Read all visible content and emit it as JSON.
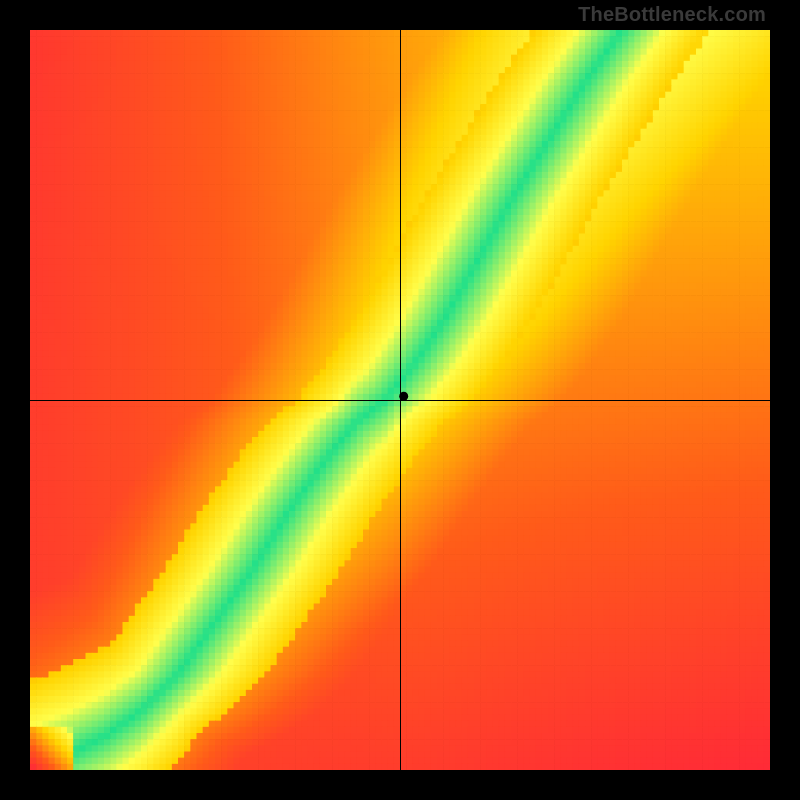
{
  "watermark": "TheBottleneck.com",
  "chart_data": {
    "type": "heatmap",
    "title": "",
    "xlabel": "",
    "ylabel": "",
    "xlim": [
      0,
      100
    ],
    "ylim": [
      0,
      100
    ],
    "resolution": 120,
    "crosshair": {
      "x": 50,
      "y": 50
    },
    "marker": {
      "x": 50.5,
      "y": 50.5
    },
    "colors": {
      "worst": "#ff1744",
      "bad": "#ff5b1a",
      "mid": "#ffd400",
      "good": "#ffff4d",
      "best": "#1fe08a"
    },
    "optimal_curve_samples": [
      {
        "x": 0,
        "y": 0
      },
      {
        "x": 5,
        "y": 2
      },
      {
        "x": 10,
        "y": 4.5
      },
      {
        "x": 15,
        "y": 8
      },
      {
        "x": 20,
        "y": 13
      },
      {
        "x": 25,
        "y": 20
      },
      {
        "x": 30,
        "y": 27
      },
      {
        "x": 35,
        "y": 35
      },
      {
        "x": 40,
        "y": 42
      },
      {
        "x": 44,
        "y": 47
      },
      {
        "x": 48,
        "y": 50
      },
      {
        "x": 52,
        "y": 55
      },
      {
        "x": 56,
        "y": 61
      },
      {
        "x": 60,
        "y": 68
      },
      {
        "x": 65,
        "y": 77
      },
      {
        "x": 70,
        "y": 85
      },
      {
        "x": 75,
        "y": 93
      },
      {
        "x": 80,
        "y": 100
      }
    ],
    "band_width": {
      "core": 5,
      "halo": 12
    }
  }
}
